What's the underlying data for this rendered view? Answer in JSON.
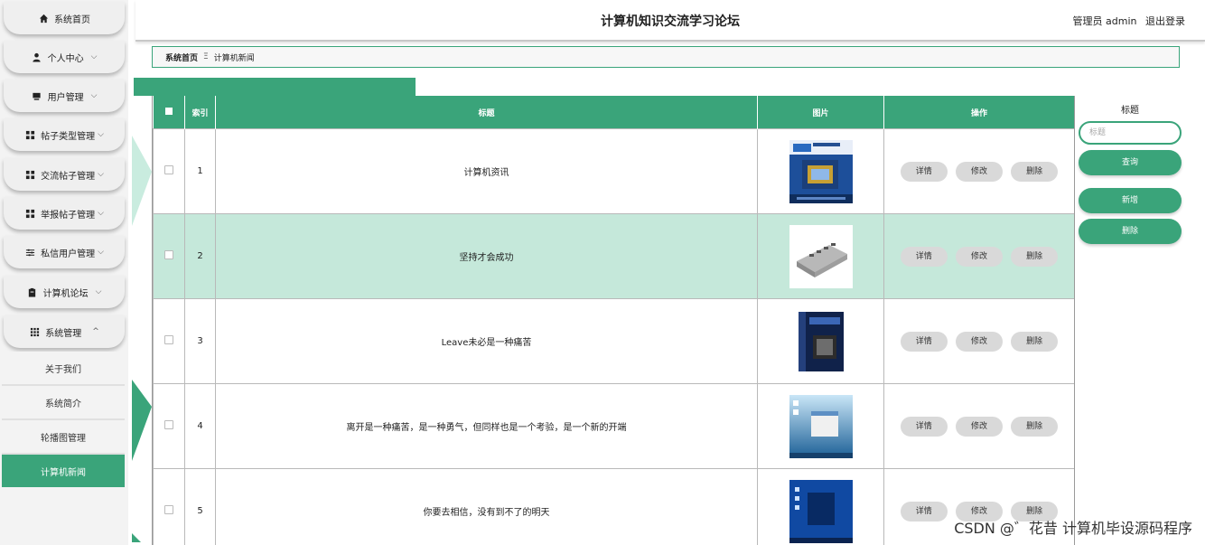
{
  "app": {
    "title": "计算机知识交流学习论坛"
  },
  "user": {
    "role_name": "管理员 admin",
    "logout": "退出登录"
  },
  "sidebar": {
    "items": [
      {
        "label": "系统首页",
        "icon": "home-icon",
        "chev": ""
      },
      {
        "label": "个人中心",
        "icon": "user-icon",
        "chev": "⌵"
      },
      {
        "label": "用户管理",
        "icon": "monitor-icon",
        "chev": "⌵"
      },
      {
        "label": "帖子类型管理",
        "icon": "grid-icon",
        "chev": "⌵"
      },
      {
        "label": "交流帖子管理",
        "icon": "grid-icon",
        "chev": "⌵"
      },
      {
        "label": "举报帖子管理",
        "icon": "grid-icon",
        "chev": "⌵"
      },
      {
        "label": "私信用户管理",
        "icon": "sliders-icon",
        "chev": "⌵"
      },
      {
        "label": "计算机论坛",
        "icon": "clipboard-icon",
        "chev": "⌵"
      },
      {
        "label": "系统管理",
        "icon": "apps-icon",
        "chev": "^"
      }
    ],
    "subitems": [
      {
        "label": "关于我们"
      },
      {
        "label": "系统简介"
      },
      {
        "label": "轮播图管理"
      },
      {
        "label": "计算机新闻"
      }
    ]
  },
  "breadcrumb": {
    "home": "系统首页",
    "sep": "Ξ",
    "current": "计算机新闻"
  },
  "table": {
    "headers": {
      "index": "索引",
      "title": "标题",
      "image": "图片",
      "action": "操作"
    },
    "rows": [
      {
        "index": "1",
        "title": "计算机资讯",
        "image_icon": "cpu-box-image"
      },
      {
        "index": "2",
        "title": "坚持才会成功",
        "image_icon": "usb-hub-image"
      },
      {
        "index": "3",
        "title": "Leave未必是一种痛苦",
        "image_icon": "software-box-image"
      },
      {
        "index": "4",
        "title": "离开是一种痛苦，是一种勇气，但同样也是一个考验，是一个新的开端",
        "image_icon": "desktop-screenshot-image"
      },
      {
        "index": "5",
        "title": "你要去相信，没有到不了的明天",
        "image_icon": "windows-start-image"
      }
    ],
    "actions": {
      "detail": "详情",
      "edit": "修改",
      "delete": "删除"
    }
  },
  "search": {
    "label": "标题",
    "placeholder": "标题",
    "query_btn": "查询",
    "add_btn": "新增",
    "delete_btn": "删除"
  },
  "watermark": "CSDN @゛花昔 计算机毕设源码程序",
  "colors": {
    "accent": "#3aa47a",
    "highlight_row": "#c5e8da"
  }
}
